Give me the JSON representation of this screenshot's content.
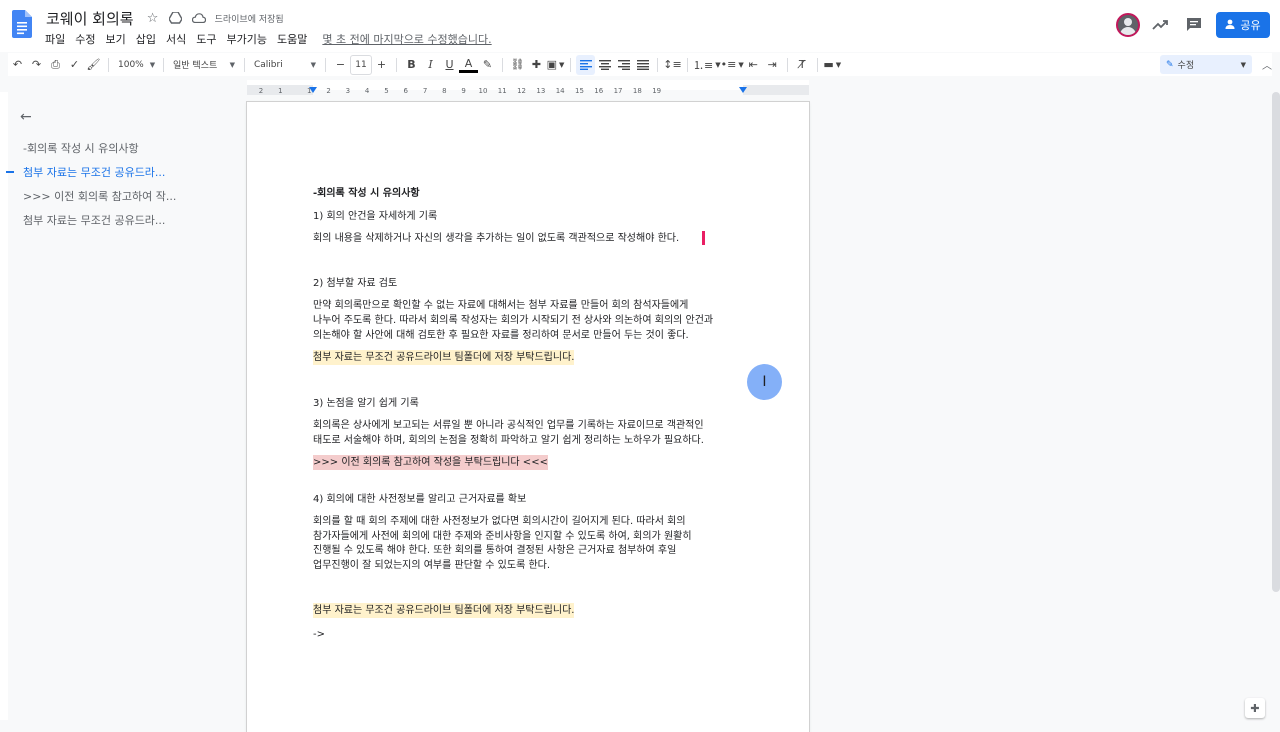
{
  "header": {
    "title": "코웨이 회의록",
    "save_status": "드라이브에 저장됨",
    "last_edit": "몇 초 전에 마지막으로 수정했습니다.",
    "share_label": "공유",
    "menus": [
      "파일",
      "수정",
      "보기",
      "삽입",
      "서식",
      "도구",
      "부가기능",
      "도움말"
    ]
  },
  "toolbar": {
    "zoom": "100%",
    "style": "일반 텍스트",
    "font": "Calibri",
    "font_size": "11",
    "mode": "수정"
  },
  "ruler_labels": [
    "2",
    "1",
    "1",
    "2",
    "3",
    "4",
    "5",
    "6",
    "7",
    "8",
    "9",
    "10",
    "11",
    "12",
    "13",
    "14",
    "15",
    "16",
    "17",
    "18",
    "19"
  ],
  "outline": {
    "items": [
      "-회의록 작성 시 유의사항",
      "첨부 자료는 무조건 공유드라...",
      ">>> 이전 회의록 참고하여 작...",
      "첨부 자료는 무조건 공유드라..."
    ]
  },
  "document": {
    "heading": "-회의록 작성 시 유의사항",
    "s1_title": "1) 회의 안건을 자세하게 기록",
    "s1_body": "회의 내용을 삭제하거나 자신의 생각을 추가하는 일이 없도록 객관적으로 작성해야 한다.",
    "s2_title": "2) 첨부할 자료 검토",
    "s2_body1": "만약 회의록만으로 확인할 수 없는 자료에 대해서는 첨부 자료를 만들어 회의 참석자들에게",
    "s2_body2": "나누어 주도록 한다. 따라서 회의록 작성자는 회의가 시작되기 전 상사와 의논하여 회의의 안건과",
    "s2_body3": "의논해야 할 사안에 대해 검토한 후 필요한 자료를 정리하여 문서로 만들어 두는 것이 좋다.",
    "note_yellow": "첨부 자료는 무조건 공유드라이브 팀폴더에 저장 부탁드립니다.",
    "s3_title": "3) 논점을 알기 쉽게 기록",
    "s3_body1": "회의록은 상사에게 보고되는 서류일 뿐 아니라 공식적인 업무를 기록하는 자료이므로 객관적인",
    "s3_body2": "태도로 서술해야 하며, 회의의 논점을 정확히 파악하고 알기 쉽게 정리하는 노하우가 필요하다.",
    "note_red": ">>> 이전 회의록 참고하여 작성을 부탁드립니다 <<<",
    "s4_title": "4) 회의에 대한 사전정보를 알리고 근거자료를 확보",
    "s4_body1": "회의를 할 때 회의 주제에 대한 사전정보가 없다면 회의시간이 길어지게 된다. 따라서 회의",
    "s4_body2": "참가자들에게 사전에 회의에 대한 주제와 준비사항을 인지할 수 있도록 하여, 회의가 원활히",
    "s4_body3": "진행될 수 있도록 해야 한다. 또한 회의를 통하여 결정된 사항은 근거자료 첨부하여 후일",
    "s4_body4": "업무진행이 잘 되었는지의 여부를 판단할 수 있도록 한다.",
    "note_yellow2": "첨부 자료는 무조건 공유드라이브 팀폴더에 저장 부탁드립니다.",
    "arrow": "->"
  }
}
